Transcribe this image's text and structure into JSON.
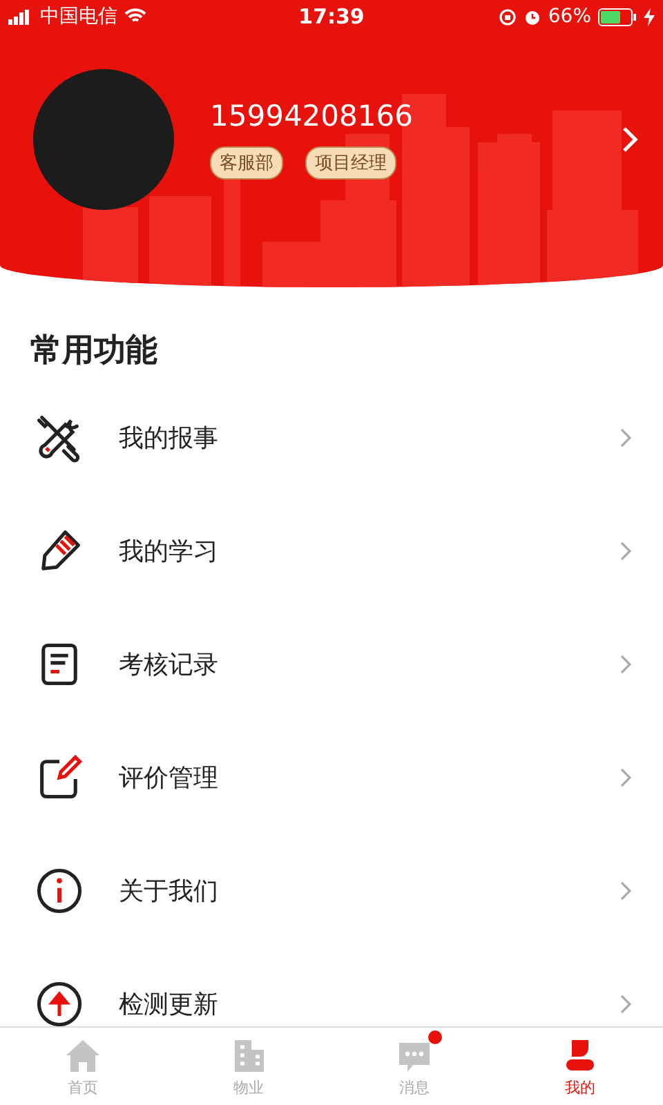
{
  "status_bar": {
    "carrier": "中国电信",
    "time": "17:39",
    "battery": "66%"
  },
  "profile": {
    "phone": "15994208166",
    "tags": [
      "客服部",
      "项目经理"
    ]
  },
  "section": {
    "title": "常用功能"
  },
  "menu_items": [
    {
      "kind": "tools",
      "label": "我的报事"
    },
    {
      "kind": "pencil",
      "label": "我的学习"
    },
    {
      "kind": "document",
      "label": "考核记录"
    },
    {
      "kind": "edit",
      "label": "评价管理"
    },
    {
      "kind": "info",
      "label": "关于我们"
    },
    {
      "kind": "update",
      "label": "检测更新"
    }
  ],
  "tab_bar": [
    {
      "kind": "home",
      "label": "首页",
      "selected": false,
      "unread": false
    },
    {
      "kind": "building",
      "label": "物业",
      "selected": false,
      "unread": false
    },
    {
      "kind": "chat",
      "label": "消息",
      "selected": false,
      "unread": true
    },
    {
      "kind": "person",
      "label": "我的",
      "selected": true,
      "unread": false
    }
  ]
}
